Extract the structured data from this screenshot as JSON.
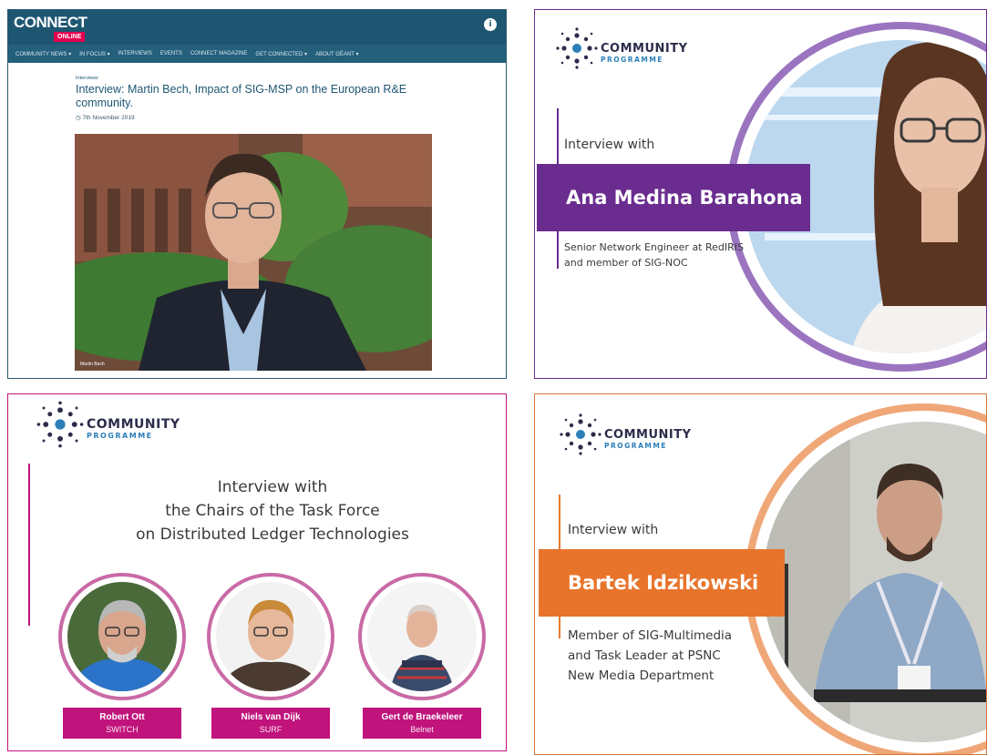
{
  "connect": {
    "logo_main": "CONNECT",
    "logo_sub": "ONLINE",
    "accessibility_glyph": "i",
    "nav": [
      "COMMUNITY NEWS ▾",
      "IN FOCUS ▾",
      "INTERVIEWS",
      "EVENTS",
      "CONNECT MAGAZINE",
      "GET CONNECTED ▾",
      "ABOUT GÉANT ▾"
    ],
    "breadcrumb": "Interviews",
    "title": "Interview: Martin Bech, Impact of SIG-MSP on the European R&E community.",
    "date": "7th November 2019",
    "photo_caption": "Martin Bech"
  },
  "community_logo": {
    "main": "COMMUNITY",
    "sub": "PROGRAMME"
  },
  "ana": {
    "intro": "Interview with",
    "name": "Ana Medina Barahona",
    "role_lines": [
      "Senior Network Engineer at RedIRIS",
      "and member of SIG-NOC"
    ]
  },
  "taskforce": {
    "heading_lines": [
      "Interview with",
      "the Chairs of the Task Force",
      "on Distributed Ledger Technologies"
    ],
    "chairs": [
      {
        "name": "Robert Ott",
        "org": "SWITCH"
      },
      {
        "name": "Niels van Dijk",
        "org": "SURF"
      },
      {
        "name": "Gert de Braekeleer",
        "org": "Belnet"
      }
    ]
  },
  "bartek": {
    "intro": "Interview with",
    "name": "Bartek Idzikowski",
    "role_lines": [
      "Member of SIG-Multimedia",
      "and Task Leader at PSNC",
      "New Media Department"
    ]
  },
  "colors": {
    "connect_blue": "#1e5672",
    "purple": "#6a2c8f",
    "magenta": "#c0137c",
    "orange": "#e8742b"
  },
  "icons": {
    "accessibility": "accessibility-icon",
    "clock": "clock-icon",
    "logo_mark": "starburst-logo-icon"
  }
}
